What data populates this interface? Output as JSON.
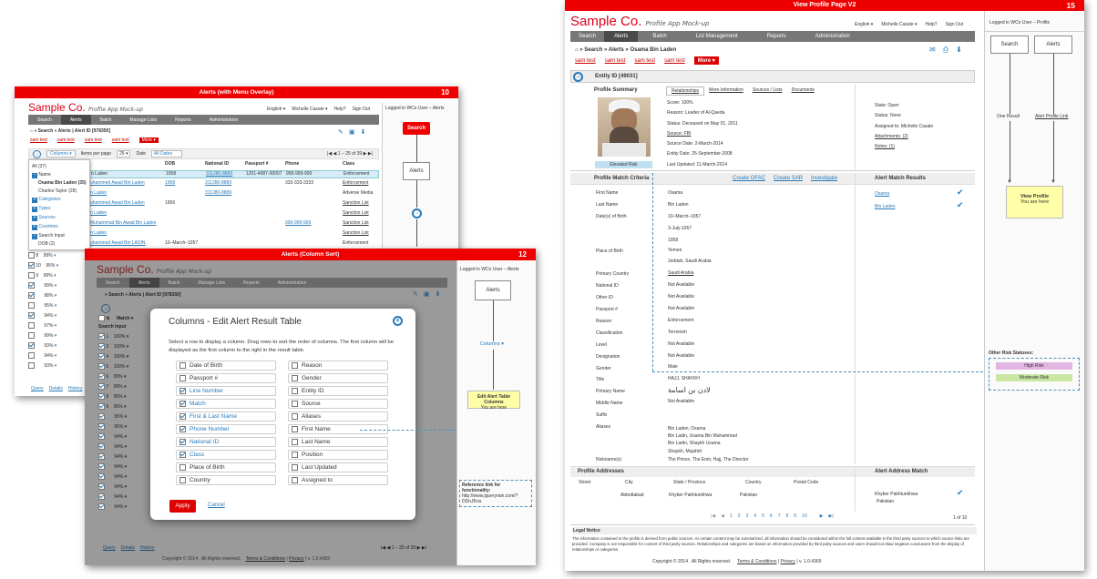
{
  "p10": {
    "banner": "Alerts (with Menu Overlay)",
    "num": "10",
    "logo": "Sample Co.",
    "sub": "Profile App Mock-up",
    "top_right": [
      "English ▾",
      "Michelle Casale ▾",
      "Help?",
      "Sign Out"
    ],
    "nav": [
      "Search",
      "Alerts",
      "Batch",
      "Manage Lists",
      "Reports",
      "Administration"
    ],
    "breadcrumb": "» Search » Alerts | Alert ID [978350]",
    "links": [
      "sam test",
      "sam test",
      "sam test",
      "sam test"
    ],
    "more": "More ▾",
    "columns_btn": "Columns ▾",
    "items_per_page": "Items per page",
    "per_page_val": "25 ▾",
    "date_label": "Date",
    "date_val": "All Dates",
    "pager": "1 – 25 of 39",
    "headers": [
      "DOB",
      "National ID",
      "Passport #",
      "Phone",
      "Class"
    ],
    "rows": [
      [
        "n Laden",
        "1958",
        "311280-8889",
        "1201-4987-00007",
        "999-999-999",
        "Enforcement"
      ],
      [
        "uhammed Awad Bin Laden",
        "1958",
        "311280-8889",
        "",
        "333-333-3333",
        "Enforcement"
      ],
      [
        "n Laden",
        "",
        "311280-8889",
        "",
        "",
        "Adverse Media"
      ],
      [
        "uhammed Awad Bin Laden",
        "1956",
        "",
        "",
        "",
        "Sanction List"
      ],
      [
        "n Laden",
        "",
        "",
        "",
        "",
        "Sanction List"
      ],
      [
        "Muhammad Bin Awad Bin Laden",
        "",
        "",
        "",
        "999-999-999",
        "Sanction List"
      ],
      [
        "n Laden",
        "",
        "",
        "",
        "",
        "Sanction List"
      ],
      [
        "uhammed Awad Bin LADIN",
        "10–March–1957",
        "",
        "",
        "",
        "Enforcement"
      ]
    ],
    "menu": {
      "all": "All (37)",
      "name": "Name",
      "n1": "Osama Bin Laden (35)",
      "n2": "Charles Taylor (28)",
      "items": [
        "Categories",
        "Types",
        "Sources",
        "Countries",
        "Search Input"
      ],
      "dob": "DOB (2)"
    },
    "left_rows": [
      [
        "8",
        "99%"
      ],
      [
        "10",
        "95%"
      ],
      [
        "9",
        "99%"
      ],
      [
        "",
        "99%"
      ],
      [
        "",
        "98%"
      ],
      [
        "",
        "95%"
      ],
      [
        "",
        "94%"
      ],
      [
        "",
        "97%"
      ],
      [
        "",
        "99%"
      ],
      [
        "",
        "93%"
      ],
      [
        "",
        "94%"
      ],
      [
        "",
        "93%"
      ]
    ],
    "footer_links": [
      "Query",
      "Details",
      "History"
    ],
    "side_title": "Logged in WCo User – Alerts",
    "flow": {
      "search": "Search",
      "alerts": "Alerts"
    }
  },
  "p12": {
    "banner": "Alerts (Column Sort)",
    "num": "12",
    "logo": "Sample Co.",
    "sub": "Profile App Mock-up",
    "side_title": "Logged in WCo User – Alerts",
    "flow": {
      "alerts": "Alerts",
      "columns": "Columns ▾",
      "edit_title": "Edit Alert Table Columns",
      "edit_sub": "You are here"
    },
    "ref": {
      "title": "Reference link for functionality:",
      "url": "http://www.jqueryrain.com/?DDnJKou"
    },
    "nav": [
      "Search",
      "Alerts",
      "Batch",
      "Manage Lists",
      "Reports",
      "Administration"
    ],
    "breadcrumb": "» Search » Alerts | Alert ID [978350]",
    "left_rows": [
      [
        "1",
        "100%"
      ],
      [
        "3",
        "100%"
      ],
      [
        "4",
        "100%"
      ],
      [
        "5",
        "100%"
      ],
      [
        "6",
        "99%"
      ],
      [
        "7",
        "99%"
      ],
      [
        "8",
        "95%"
      ],
      [
        "9",
        "95%"
      ],
      [
        "",
        "95%"
      ],
      [
        "",
        "95%"
      ],
      [
        "",
        "94%"
      ],
      [
        "",
        "94%"
      ],
      [
        "",
        "94%"
      ],
      [
        "",
        "94%"
      ],
      [
        "",
        "94%"
      ],
      [
        "",
        "94%"
      ],
      [
        "",
        "94%"
      ],
      [
        "",
        "94%"
      ]
    ],
    "footer": "Copyright © 2014 . All Rights reserved.",
    "footer_links": [
      "Terms & Conditions",
      "Privacy",
      "v. 1.0.4369"
    ],
    "bottom_links": [
      "Query",
      "Details",
      "History"
    ],
    "pager": "1 – 25 of 39",
    "modal": {
      "title": "Columns - Edit Alert Result Table",
      "desc": "Select a row to display a column. Drag rows to sort the order of columns. The first column will be displayed as the first column to the right in the result table.",
      "left": [
        {
          "label": "Date of Birth",
          "checked": false
        },
        {
          "label": "Passport #",
          "checked": false
        },
        {
          "label": "Line Number",
          "checked": true
        },
        {
          "label": "Match",
          "checked": true
        },
        {
          "label": "First & Last Name",
          "checked": true
        },
        {
          "label": "Phone Number",
          "checked": true
        },
        {
          "label": "National ID",
          "checked": true
        },
        {
          "label": "Class",
          "checked": true
        },
        {
          "label": "Place of Birth",
          "checked": false
        },
        {
          "label": "Country",
          "checked": false
        }
      ],
      "right": [
        {
          "label": "Reason",
          "checked": false
        },
        {
          "label": "Gender",
          "checked": false
        },
        {
          "label": "Entity ID",
          "checked": false
        },
        {
          "label": "Source",
          "checked": false
        },
        {
          "label": "Aliases",
          "checked": false
        },
        {
          "label": "First Name",
          "checked": false
        },
        {
          "label": "Last Name",
          "checked": false
        },
        {
          "label": "Position",
          "checked": false
        },
        {
          "label": "Last Updated",
          "checked": false
        },
        {
          "label": "Assigned to",
          "checked": false
        }
      ],
      "apply": "Apply",
      "cancel": "Cancel"
    }
  },
  "p15": {
    "banner": "View Profile Page V2",
    "num": "15",
    "logo": "Sample Co.",
    "sub": "Profile App Mock-up",
    "top_right": [
      "English ▾",
      "Michelle Casale ▾",
      "Help?",
      "Sign Out"
    ],
    "nav": [
      "Search",
      "Alerts",
      "Batch",
      "List Management",
      "Reports",
      "Administration"
    ],
    "breadcrumb": "» Search » Alerts » Osama Bin Laden",
    "links": [
      "sam test",
      "sam test",
      "sam test",
      "sam test"
    ],
    "more": "More",
    "entity": "Entity ID [49031]",
    "tabs": [
      "Relationships",
      "More Information",
      "Sources / Lists",
      "Documents"
    ],
    "summary_title": "Profile Summary",
    "risk": "Elevated Risk",
    "summary": [
      "Score: 100%",
      "Reason: Leader of Al-Qaeda",
      "Status: Deceased on May 01, 2011",
      "Source: FBI",
      "Source Date: 2-March-2014",
      "Entity Date: 25-September-2008",
      "Last Updated: 11-March-2014"
    ],
    "state": [
      "State: Open",
      "Status: None",
      "Assigned to: Michelle Casale",
      "Attachments: (2)",
      "Notes: (1)"
    ],
    "criteria_title": "Profile Match Criteria",
    "actions": [
      "Create OFAC",
      "Create SAR",
      "Investigate"
    ],
    "results_title": "Alert Match Results",
    "results": [
      "Osama",
      "Bin Laden"
    ],
    "criteria": [
      [
        "First Name",
        "Osama"
      ],
      [
        "Last Name",
        "Bin Laden"
      ],
      [
        "Date(s) of Birth",
        "10–March–1957"
      ],
      [
        "",
        "3-July-1957"
      ],
      [
        "",
        "1958"
      ],
      [
        "Place of Birth",
        "Yemen"
      ],
      [
        "",
        "Jeddah, Saudi Arabia"
      ],
      [
        "Primary Country",
        "Saudi Arabia"
      ],
      [
        "National ID",
        "Not Available"
      ],
      [
        "Other ID",
        "Not Available"
      ],
      [
        "Passport #",
        "Not Available"
      ],
      [
        "Reason",
        "Enforcement"
      ],
      [
        "Classification",
        "Terrorism"
      ],
      [
        "Level",
        "Not Available"
      ],
      [
        "Designation",
        "Not Available"
      ],
      [
        "Gender",
        "Male"
      ],
      [
        "Title",
        "HAJJ, SHAYKH"
      ],
      [
        "Primary Name",
        "لادن بن اسامة"
      ],
      [
        "Middle Name",
        "Not Available"
      ],
      [
        "Suffix",
        ""
      ],
      [
        "Aliases",
        "Bin Laden, Osama"
      ],
      [
        "",
        "Bin Ladin, Usama Bin Muhammad"
      ],
      [
        "",
        "Bin Ladin, Shaykh Usama"
      ],
      [
        "",
        "Shaykh, Mujahid"
      ],
      [
        "Nickname(s)",
        "The Prince, The Emir, Hajj, The Director"
      ]
    ],
    "addr_title": "Profile Addresses",
    "addr_match_title": "Alert Address Match",
    "addr_headers": [
      "Street",
      "City",
      "State / Province",
      "Country",
      "Postal Code"
    ],
    "addr_row": [
      "",
      "Abbottabad",
      "Khyber Pakhtunkhwa",
      "Pakistan",
      ""
    ],
    "addr_match": [
      "Khyber Pakhtunkhwa",
      "Pakistan"
    ],
    "pages": [
      "1",
      "2",
      "3",
      "4",
      "5",
      "6",
      "7",
      "8",
      "9",
      "10"
    ],
    "page_of": "1 of 10",
    "legal_title": "Legal Notice",
    "legal": "The information contained in the profile is derived from public sources. As certain content may be summarized, all information should be considered within the full content available in the third party sources to which source links are provided. Company is not responsible for content of third party sources. Relationships and categories are based on information provided by third party sources and users should not draw negative conclusions from the display of relationships or categories.",
    "footer": "Copyright © 2014 . All Rights reserved.",
    "footer_links": [
      "Terms & Conditions",
      "Privacy",
      "v. 1.0.4369"
    ],
    "side_title": "Logged in WCo User – Profile",
    "flow": {
      "search": "Search",
      "alerts": "Alerts",
      "one_result": "One Result",
      "alert_link": "Alert Profile Link",
      "view_title": "View Profile",
      "view_sub": "You are here",
      "risk_title": "Other Risk Statuses:",
      "high": "High Risk",
      "moderate": "Moderate Risk"
    }
  }
}
